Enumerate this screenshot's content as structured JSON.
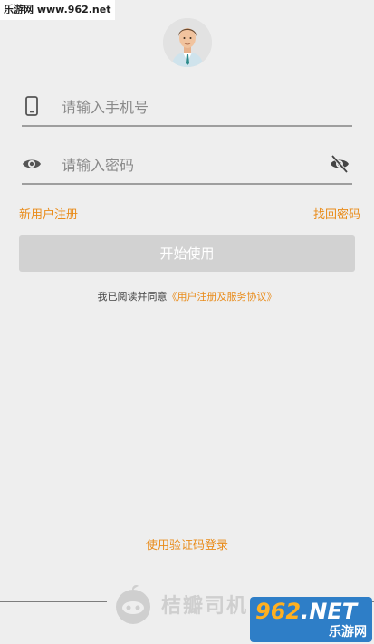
{
  "watermark_top": "乐游网 www.962.net",
  "phone_field": {
    "placeholder": "请输入手机号",
    "value": ""
  },
  "password_field": {
    "placeholder": "请输入密码",
    "value": ""
  },
  "links": {
    "register": "新用户注册",
    "find_password": "找回密码"
  },
  "start_button": "开始使用",
  "agreement": {
    "prefix": "我已阅读并同意",
    "link": "《用户注册及服务协议》"
  },
  "code_login": "使用验证码登录",
  "brand": "桔瓣司机",
  "watermark_bottom": {
    "main_prefix": "962",
    "main_suffix": ".NET",
    "sub": "乐游网"
  },
  "colors": {
    "accent": "#e98c1b",
    "background": "#eeeeee",
    "button_disabled": "#d2d2d2"
  }
}
